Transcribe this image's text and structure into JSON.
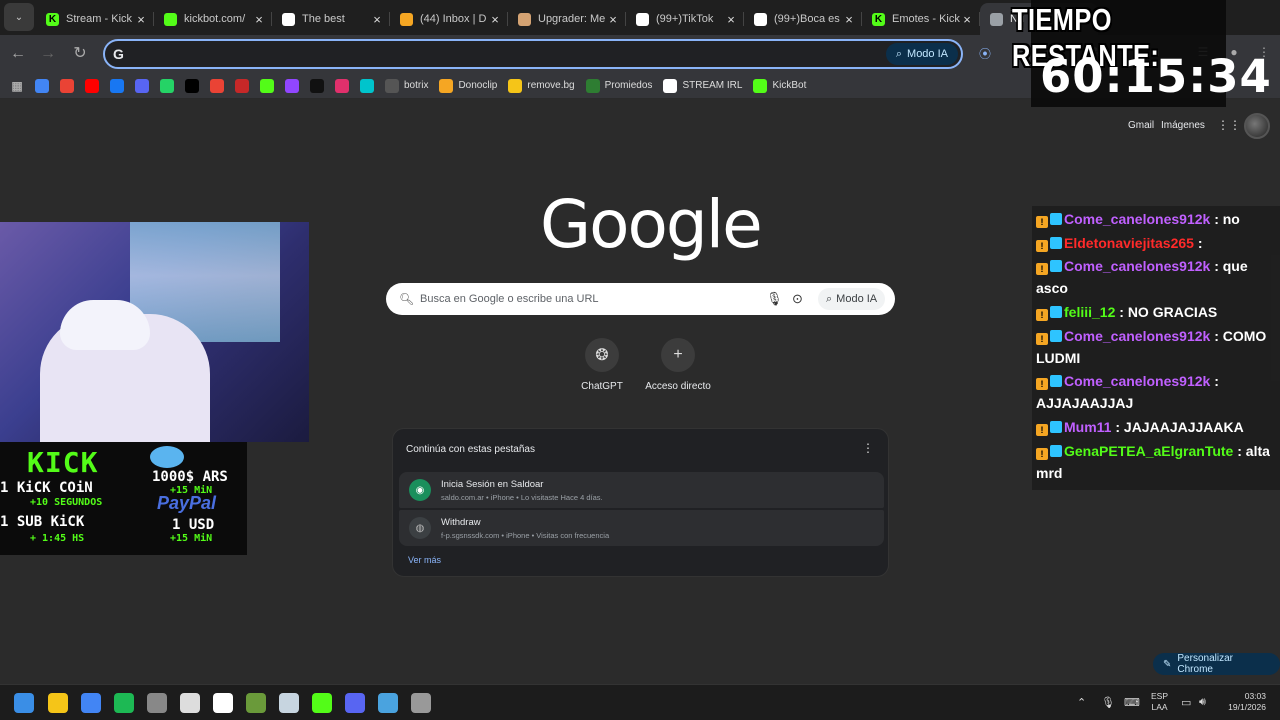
{
  "tabs": [
    {
      "title": "Stream - Kick",
      "icon": "kick-icon",
      "color": "#53fc18",
      "active": false
    },
    {
      "title": "kickbot.com/",
      "icon": "kickbot-icon",
      "color": "#53fc18",
      "active": false
    },
    {
      "title": "The best",
      "icon": "diamond-icon",
      "color": "#ffffff",
      "active": false
    },
    {
      "title": "(44) Inbox | D",
      "icon": "mail-icon",
      "color": "#f5a623",
      "active": false
    },
    {
      "title": "Upgrader: Me",
      "icon": "gift-icon",
      "color": "#d4a373",
      "active": false
    },
    {
      "title": "(99+)TikTok",
      "icon": "tiktok-icon",
      "color": "#ffffff",
      "active": false
    },
    {
      "title": "(99+)Boca es",
      "icon": "tiktok-icon",
      "color": "#ffffff",
      "active": false
    },
    {
      "title": "Emotes - Kick",
      "icon": "kick-icon",
      "color": "#53fc18",
      "active": false
    },
    {
      "title": "Nu",
      "icon": "chrome-icon",
      "color": "#9aa0a6",
      "active": true
    }
  ],
  "toolbar": {
    "omnibox_prefix": "G",
    "modo_ia": "Modo IA"
  },
  "bookmarks": [
    {
      "label": "",
      "icon": "translate-icon",
      "color": "#4285f4"
    },
    {
      "label": "",
      "icon": "gmail-icon",
      "color": "#ea4335"
    },
    {
      "label": "",
      "icon": "youtube-icon",
      "color": "#ff0000"
    },
    {
      "label": "",
      "icon": "facebook-icon",
      "color": "#1877f2"
    },
    {
      "label": "",
      "icon": "discord-icon",
      "color": "#5865f2"
    },
    {
      "label": "",
      "icon": "whatsapp-icon",
      "color": "#25d366"
    },
    {
      "label": "",
      "icon": "x-icon",
      "color": "#000000"
    },
    {
      "label": "",
      "icon": "gmail-icon",
      "color": "#ea4335"
    },
    {
      "label": "",
      "icon": "red-icon",
      "color": "#c62828"
    },
    {
      "label": "",
      "icon": "kick-icon",
      "color": "#53fc18"
    },
    {
      "label": "",
      "icon": "twitch-icon",
      "color": "#9146ff"
    },
    {
      "label": "",
      "icon": "tiktok-icon",
      "color": "#111111"
    },
    {
      "label": "",
      "icon": "instagram-icon",
      "color": "#e1306c"
    },
    {
      "label": "",
      "icon": "canva-icon",
      "color": "#00c4cc"
    },
    {
      "label": "botrix",
      "icon": "botrix-icon",
      "color": "#555555"
    },
    {
      "label": "Donoclip",
      "icon": "donoclip-icon",
      "color": "#f5a623"
    },
    {
      "label": "remove.bg",
      "icon": "removebg-icon",
      "color": "#f5c518"
    },
    {
      "label": "Promiedos",
      "icon": "promiedos-icon",
      "color": "#2e7d32"
    },
    {
      "label": "STREAM IRL",
      "icon": "irl-icon",
      "color": "#ffffff"
    },
    {
      "label": "KickBot",
      "icon": "kickbot-icon",
      "color": "#53fc18"
    }
  ],
  "header": {
    "gmail": "Gmail",
    "images": "Imágenes"
  },
  "google": {
    "logo": "Google",
    "search_placeholder": "Busca en Google o escribe una URL",
    "modo_ia": "Modo IA"
  },
  "shortcuts": [
    {
      "label": "ChatGPT",
      "icon": "chatgpt-icon"
    },
    {
      "label": "Acceso directo",
      "icon": "plus-icon"
    }
  ],
  "continue_card": {
    "title": "Continúa con estas pestañas",
    "items": [
      {
        "title": "Inicia Sesión en Saldoar",
        "subtitle": "saldo.com.ar • iPhone • Lo visitaste Hace 4 días.",
        "icon": "saldoar-icon"
      },
      {
        "title": "Withdraw",
        "subtitle": "f-p.sgsnssdk.com • iPhone • Visitas con frecuencia",
        "icon": "globe-icon"
      }
    ],
    "more": "Ver más"
  },
  "personalize": "Personalizar Chrome",
  "timer": {
    "label": "TIEMPO RESTANTE:",
    "value": "60:15:34"
  },
  "chat": [
    {
      "user": "Come_canelones912k",
      "color": "#c060ff",
      "text": " : no"
    },
    {
      "user": "Eldetonaviejitas265",
      "color": "#ff2a2a",
      "text": " : "
    },
    {
      "user": "Come_canelones912k",
      "color": "#c060ff",
      "text": " : que asco"
    },
    {
      "user": "feliii_12",
      "color": "#53fc18",
      "text": " : NO GRACIAS"
    },
    {
      "user": "Come_canelones912k",
      "color": "#c060ff",
      "text": " : COMO LUDMI"
    },
    {
      "user": "Come_canelones912k",
      "color": "#c060ff",
      "text": " : AJJAJAAJJAJ"
    },
    {
      "user": "Mum11",
      "color": "#c060ff",
      "text": " : JAJAAJAJJAAKA"
    },
    {
      "user": "GenaPETEA_aElgranTute",
      "color": "#53fc18",
      "text": " : alta mrd"
    }
  ],
  "promo": {
    "kick": "KICK",
    "kick_coin": "1 KiCK COiN",
    "kick_coin_bonus": "+10 SEGUNDOS",
    "sub_kick": "1 SUB KiCK",
    "sub_kick_bonus": "+ 1:45 HS",
    "ars": "1000$ ARS",
    "ars_bonus": "+15 MiN",
    "paypal": "PayPal",
    "usd": "1 USD",
    "usd_bonus": "+15 MiN"
  },
  "taskbar": {
    "apps": [
      {
        "icon": "windows-icon",
        "color": "#3a8ee6"
      },
      {
        "icon": "folder-icon",
        "color": "#f5c518"
      },
      {
        "icon": "chrome-icon",
        "color": "#4285f4"
      },
      {
        "icon": "spotify-icon",
        "color": "#1db954"
      },
      {
        "icon": "app-icon",
        "color": "#888888"
      },
      {
        "icon": "obs-icon",
        "color": "#dddddd"
      },
      {
        "icon": "tf-icon",
        "color": "#ffffff"
      },
      {
        "icon": "minecraft-icon",
        "color": "#6a9a3a"
      },
      {
        "icon": "steam-icon",
        "color": "#c7d5e0"
      },
      {
        "icon": "kick-icon",
        "color": "#53fc18"
      },
      {
        "icon": "discord-icon",
        "color": "#5865f2"
      },
      {
        "icon": "photos-icon",
        "color": "#4aa3df"
      },
      {
        "icon": "cube-icon",
        "color": "#999999"
      }
    ],
    "lang_top": "ESP",
    "lang_bottom": "LAA",
    "time": "03:03",
    "date": "19/1/2026"
  }
}
